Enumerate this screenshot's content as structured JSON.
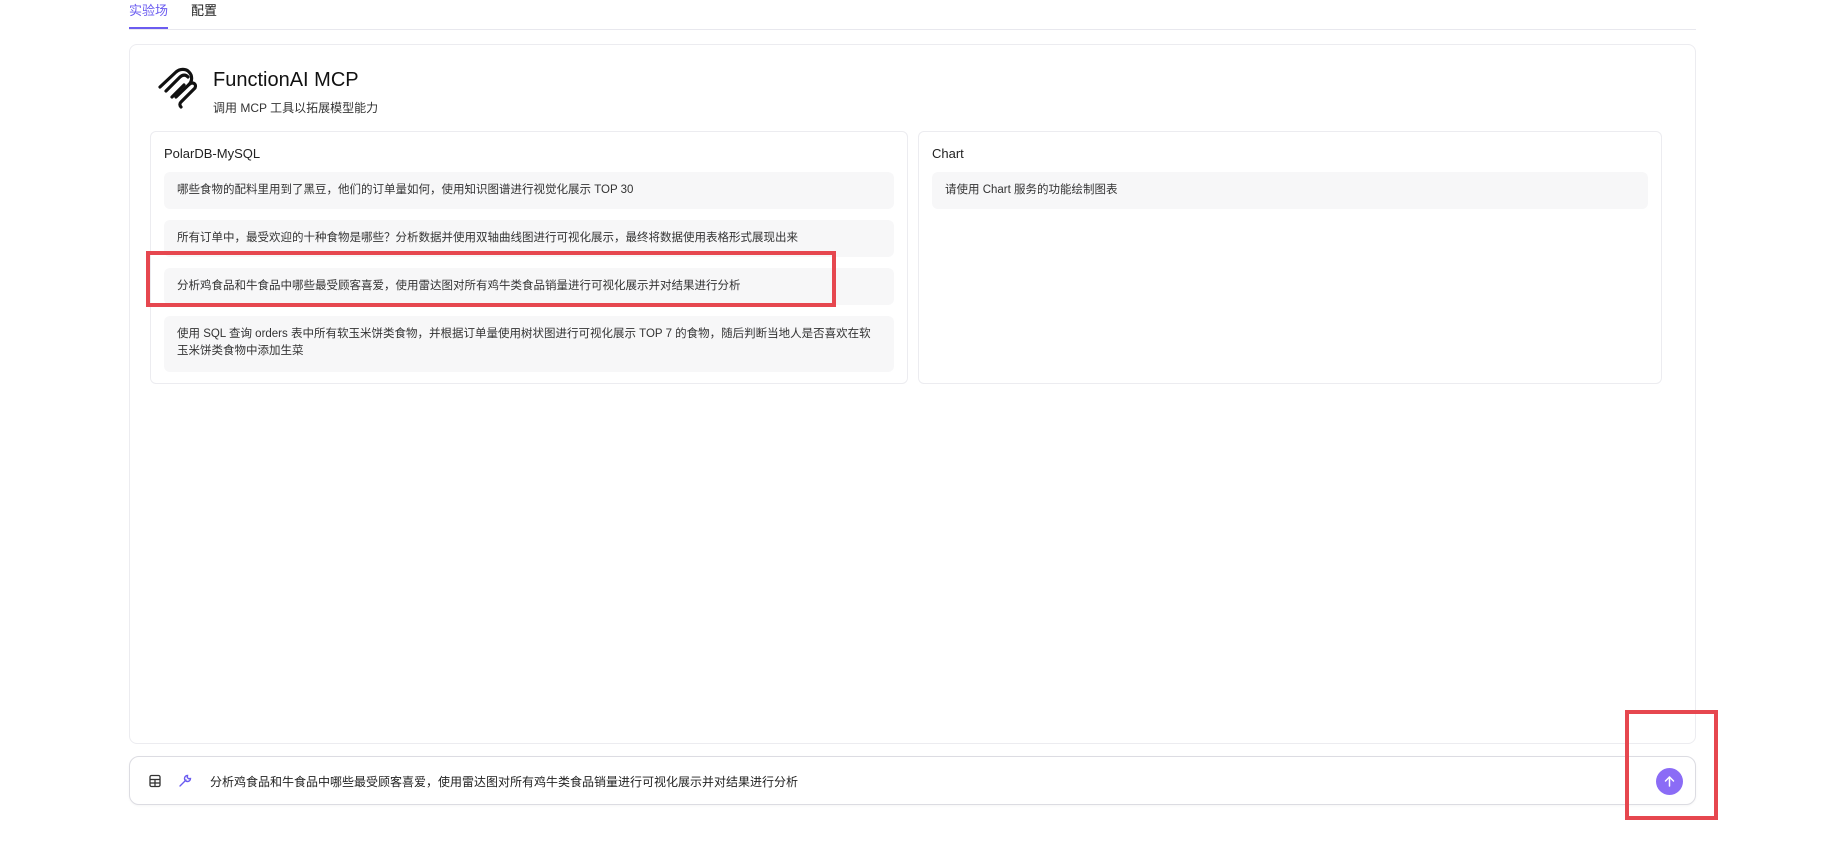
{
  "tabs": [
    {
      "label": "实验场",
      "active": true
    },
    {
      "label": "配置",
      "active": false
    }
  ],
  "header": {
    "title": "FunctionAI MCP",
    "subtitle": "调用 MCP 工具以拓展模型能力",
    "logo_icon": "mcp-logo-icon"
  },
  "servers": [
    {
      "name": "PolarDB-MySQL",
      "prompts": [
        "哪些食物的配料里用到了黑豆，他们的订单量如何，使用知识图谱进行视觉化展示 TOP 30",
        "所有订单中，最受欢迎的十种食物是哪些？分析数据并使用双轴曲线图进行可视化展示，最终将数据使用表格形式展现出来",
        "分析鸡食品和牛食品中哪些最受顾客喜爱，使用雷达图对所有鸡牛类食品销量进行可视化展示并对结果进行分析",
        "使用 SQL 查询 orders 表中所有软玉米饼类食物，并根据订单量使用树状图进行可视化展示 TOP 7 的食物，随后判断当地人是否喜欢在软玉米饼类食物中添加生菜"
      ]
    },
    {
      "name": "Chart",
      "prompts": [
        "请使用 Chart 服务的功能绘制图表"
      ]
    }
  ],
  "input": {
    "value": "分析鸡食品和牛食品中哪些最受顾客喜爱，使用雷达图对所有鸡牛类食品销量进行可视化展示并对结果进行分析",
    "placeholder": "",
    "left_icons": [
      "database-icon",
      "wrench-icon"
    ],
    "send_icon": "arrow-up-icon"
  },
  "colors": {
    "accent": "#6b5cf0",
    "send_button": "#8b6cf6",
    "highlight": "#e6474f"
  }
}
